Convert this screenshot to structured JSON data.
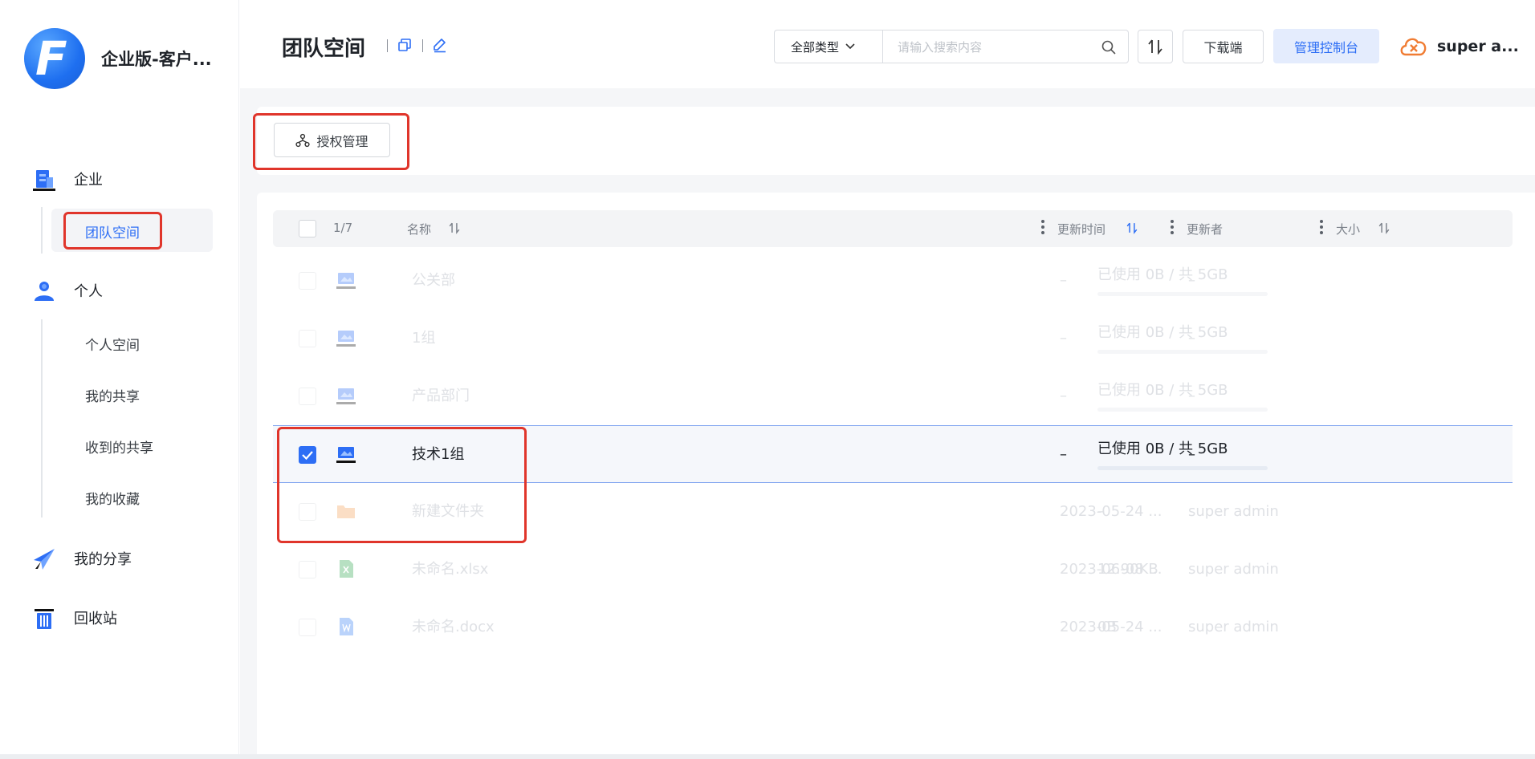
{
  "app": {
    "name": "企业版-客户...",
    "logo_letter": "F"
  },
  "sidebar": {
    "enterprise": {
      "label": "企业",
      "items": [
        {
          "label": "团队空间"
        }
      ]
    },
    "personal": {
      "label": "个人",
      "items": [
        {
          "label": "个人空间"
        },
        {
          "label": "我的共享"
        },
        {
          "label": "收到的共享"
        },
        {
          "label": "我的收藏"
        }
      ]
    },
    "my_share": {
      "label": "我的分享"
    },
    "recycle": {
      "label": "回收站"
    }
  },
  "header": {
    "title": "团队空间",
    "type_select": {
      "value": "全部类型"
    },
    "search": {
      "placeholder": "请输入搜索内容"
    },
    "download_label": "下载端",
    "admin_label": "管理控制台",
    "user_name": "super a..."
  },
  "toolbar": {
    "auth_label": "授权管理"
  },
  "table": {
    "selection_count": "1/7",
    "columns": {
      "name": "名称",
      "updated": "更新时间",
      "updater": "更新者",
      "size": "大小"
    },
    "rows": [
      {
        "name": "公关部",
        "updated": "–",
        "updater": "–",
        "size": "已使用 0B / 共 5GB",
        "type": "team"
      },
      {
        "name": "1组",
        "updated": "–",
        "updater": "–",
        "size": "已使用 0B / 共 5GB",
        "type": "team"
      },
      {
        "name": "产品部门",
        "updated": "–",
        "updater": "–",
        "size": "已使用 0B / 共 5GB",
        "type": "team"
      },
      {
        "name": "技术1组",
        "updated": "–",
        "updater": "–",
        "size": "已使用 0B / 共 5GB",
        "type": "team",
        "selected": true
      },
      {
        "name": "新建文件夹",
        "updated": "2023-05-24 ...",
        "updater": "super admin",
        "size": "–",
        "type": "folder"
      },
      {
        "name": "未命名.xlsx",
        "updated": "2023-06-08 ...",
        "updater": "super admin",
        "size": "12.90KB",
        "type": "xlsx"
      },
      {
        "name": "未命名.docx",
        "updated": "2023-05-24 ...",
        "updater": "super admin",
        "size": "0B",
        "type": "docx"
      }
    ]
  },
  "colors": {
    "accent": "#2d6ef5",
    "highlight": "#e0352b"
  }
}
